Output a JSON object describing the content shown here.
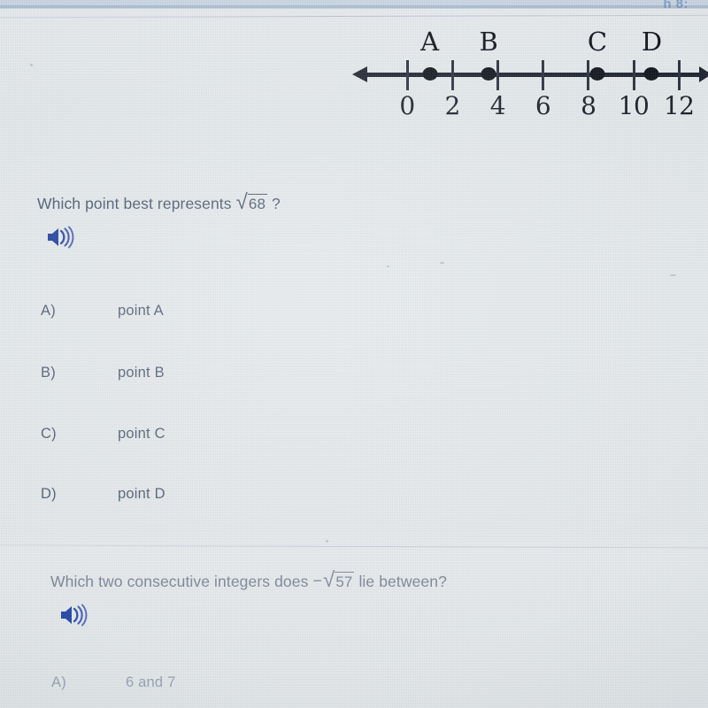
{
  "top_chrome": {
    "fragment_text": "h 8:"
  },
  "number_line": {
    "tick_labels": [
      "0",
      "2",
      "4",
      "6",
      "8",
      "10",
      "12"
    ],
    "tick_values": [
      0,
      2,
      4,
      6,
      8,
      10,
      12
    ],
    "points": [
      {
        "label": "A",
        "value": 1.0
      },
      {
        "label": "B",
        "value": 3.6
      },
      {
        "label": "C",
        "value": 8.4
      },
      {
        "label": "D",
        "value": 10.8
      }
    ],
    "arrow_left": "left-arrowhead",
    "arrow_right": "right-arrowhead"
  },
  "question_1": {
    "prompt_before": "Which point best represents",
    "radical_radicand": "68",
    "prompt_after": "?",
    "audio_icon": "speaker-icon",
    "options": [
      {
        "letter": "A)",
        "text": "point A"
      },
      {
        "letter": "B)",
        "text": "point B"
      },
      {
        "letter": "C)",
        "text": "point C"
      },
      {
        "letter": "D)",
        "text": "point D"
      }
    ]
  },
  "question_2": {
    "prompt_before": "Which two consecutive integers does",
    "minus": "−",
    "radical_radicand": "57",
    "prompt_after": "lie between?",
    "audio_icon": "speaker-icon",
    "options": [
      {
        "letter": "A)",
        "text": "6 and 7"
      }
    ]
  },
  "colors": {
    "background": "#e3e8ea",
    "text_primary": "#4a5a71",
    "text_faded": "#7a8699",
    "diagram_ink": "#10141d",
    "speaker_blue": "#1f3fa0"
  }
}
